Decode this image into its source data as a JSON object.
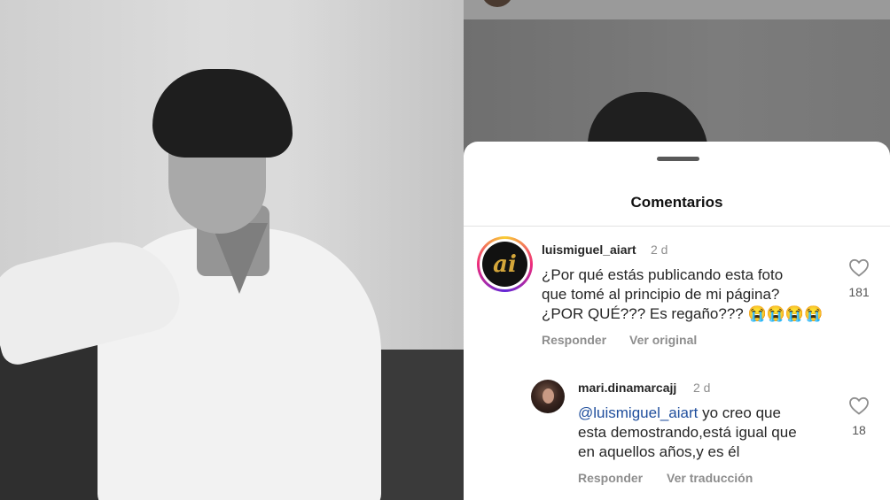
{
  "sheet": {
    "title": "Comentarios"
  },
  "comments": [
    {
      "username": "luismiguel_aiart",
      "time": "2 d",
      "avatar_text": "ai",
      "text_lines": [
        "¿Por qué estás publicando esta foto",
        "que tomé al principio de mi página?",
        "¿POR QUÉ??? Es regaño??? 😭😭😭😭"
      ],
      "reply_label": "Responder",
      "secondary_label": "Ver original",
      "likes": "181"
    },
    {
      "username": "mari.dinamarcajj",
      "time": "2 d",
      "mention": "@luismiguel_aiart",
      "text_first_rest": " yo creo que",
      "text_lines": [
        "esta demostrando,está igual que",
        "en aquellos años,y es él"
      ],
      "reply_label": "Responder",
      "secondary_label": "Ver traducción",
      "likes": "18"
    }
  ],
  "colors": {
    "text": "#262626",
    "muted": "#8e8e8e",
    "mention": "#1f4e9c",
    "sheet_bg": "#ffffff"
  }
}
